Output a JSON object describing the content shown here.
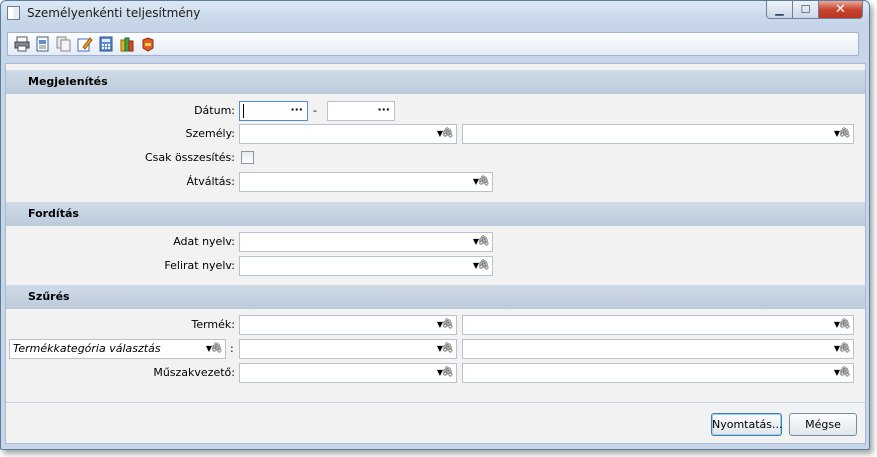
{
  "window": {
    "title": "Személyenkénti teljesítmény",
    "controls": {
      "minimize": "▁",
      "maximize": "☐",
      "close": "✕"
    }
  },
  "toolbar": {
    "icons": [
      "print-icon",
      "print-preview-icon",
      "copy-icon",
      "edit-icon",
      "calculator-icon",
      "stack-icon",
      "export-icon"
    ]
  },
  "sections": {
    "display": "Megjelenítés",
    "translation": "Fordítás",
    "filter": "Szűrés"
  },
  "fields": {
    "date_label": "Dátum:",
    "date_separator": "-",
    "person_label": "Személy:",
    "summary_only_label": "Csak összesítés:",
    "conversion_label": "Átváltás:",
    "data_language_label": "Adat nyelv:",
    "caption_language_label": "Felirat nyelv:",
    "product_label": "Termék:",
    "category_selector_value": "Termékkategória választás",
    "category_colon": ":",
    "shift_leader_label": "Műszakvezető:"
  },
  "buttons": {
    "print": "Nyomtatás...",
    "cancel": "Mégse"
  },
  "glyphs": {
    "dropdown": "▼",
    "clip": "🖇",
    "ellipsis": "···"
  },
  "colors": {
    "section_bg": "#c5d3e2",
    "panel_bg": "#f2f2f2",
    "focus_border": "#4c8ed9"
  }
}
